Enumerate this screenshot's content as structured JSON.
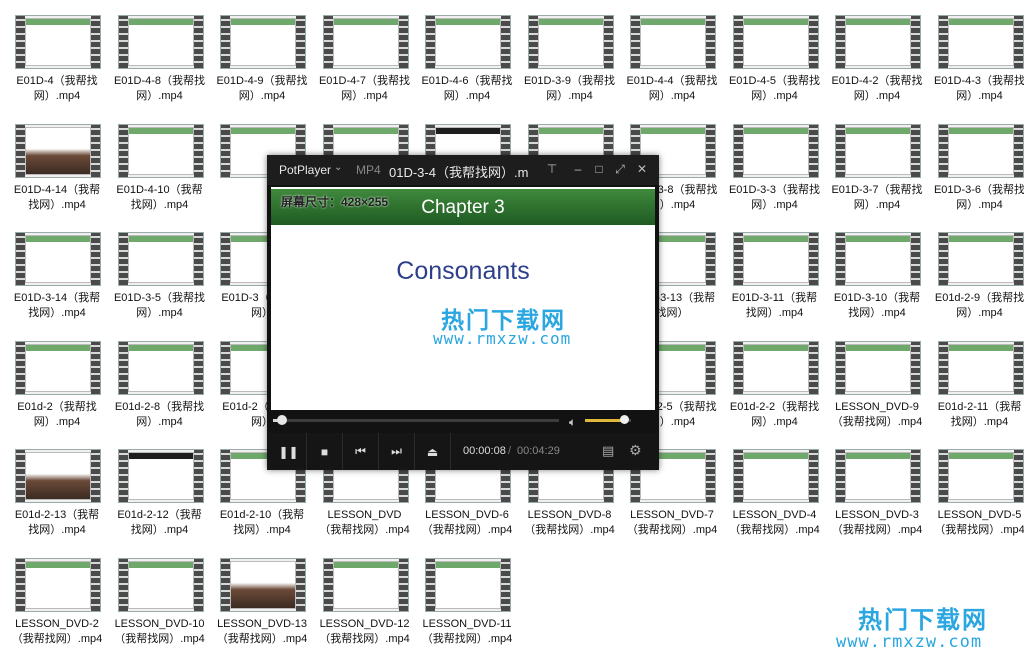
{
  "files": [
    {
      "name": "E01D-4（我帮找网）.mp4",
      "thumb": "green"
    },
    {
      "name": "E01D-4-8（我帮找网）.mp4",
      "thumb": "green"
    },
    {
      "name": "E01D-4-9（我帮找网）.mp4",
      "thumb": "green"
    },
    {
      "name": "E01D-4-7（我帮找网）.mp4",
      "thumb": "green"
    },
    {
      "name": "E01D-4-6（我帮找网）.mp4",
      "thumb": "green"
    },
    {
      "name": "E01D-3-9（我帮找网）.mp4",
      "thumb": "green"
    },
    {
      "name": "E01D-4-4（我帮找网）.mp4",
      "thumb": "green"
    },
    {
      "name": "E01D-4-5（我帮找网）.mp4",
      "thumb": "green"
    },
    {
      "name": "E01D-4-2（我帮找网）.mp4",
      "thumb": "green"
    },
    {
      "name": "E01D-4-3（我帮找网）.mp4",
      "thumb": "green"
    },
    {
      "name": "E01D-4-14（我帮找网）.mp4",
      "thumb": "photo"
    },
    {
      "name": "E01D-4-10（我帮找网）.mp4",
      "thumb": "green"
    },
    {
      "name": "",
      "thumb": "green"
    },
    {
      "name": "",
      "thumb": "green"
    },
    {
      "name": "",
      "thumb": "dark"
    },
    {
      "name": "",
      "thumb": "green"
    },
    {
      "name": "E01D-3-8（我帮找网）.mp4",
      "thumb": "green"
    },
    {
      "name": "E01D-3-3（我帮找网）.mp4",
      "thumb": "green"
    },
    {
      "name": "E01D-3-7（我帮找网）.mp4",
      "thumb": "green"
    },
    {
      "name": "E01D-3-6（我帮找网）.mp4",
      "thumb": "green"
    },
    {
      "name": "E01D-3-14（我帮找网）.mp4",
      "thumb": "green"
    },
    {
      "name": "E01D-3-5（我帮找网）.mp4",
      "thumb": "green"
    },
    {
      "name": "E01D-3（我帮找网）",
      "thumb": "green"
    },
    {
      "name": "",
      "thumb": "green"
    },
    {
      "name": "",
      "thumb": "green"
    },
    {
      "name": "",
      "thumb": "green"
    },
    {
      "name": "E01D-3-13（我帮找网）",
      "thumb": "green"
    },
    {
      "name": "E01D-3-11（我帮找网）.mp4",
      "thumb": "green"
    },
    {
      "name": "E01D-3-10（我帮找网）.mp4",
      "thumb": "green"
    },
    {
      "name": "E01d-2-9（我帮找网）.mp4",
      "thumb": "green"
    },
    {
      "name": "E01d-2（我帮找网）.mp4",
      "thumb": "green"
    },
    {
      "name": "E01d-2-8（我帮找网）.mp4",
      "thumb": "green"
    },
    {
      "name": "E01d-2（我帮找网）",
      "thumb": "green"
    },
    {
      "name": "",
      "thumb": "green"
    },
    {
      "name": "",
      "thumb": "green"
    },
    {
      "name": "",
      "thumb": "green"
    },
    {
      "name": "E01d-2-5（我帮找网）.mp4",
      "thumb": "green"
    },
    {
      "name": "E01d-2-2（我帮找网）.mp4",
      "thumb": "green"
    },
    {
      "name": "LESSON_DVD-9（我帮找网）.mp4",
      "thumb": "green"
    },
    {
      "name": "E01d-2-11（我帮找网）.mp4",
      "thumb": "green"
    },
    {
      "name": "E01d-2-13（我帮找网）.mp4",
      "thumb": "photo"
    },
    {
      "name": "E01d-2-12（我帮找网）.mp4",
      "thumb": "dark"
    },
    {
      "name": "E01d-2-10（我帮找网）.mp4",
      "thumb": "green"
    },
    {
      "name": "LESSON_DVD（我帮找网）.mp4",
      "thumb": "green"
    },
    {
      "name": "LESSON_DVD-6（我帮找网）.mp4",
      "thumb": "green"
    },
    {
      "name": "LESSON_DVD-8（我帮找网）.mp4",
      "thumb": "green"
    },
    {
      "name": "LESSON_DVD-7（我帮找网）.mp4",
      "thumb": "green"
    },
    {
      "name": "LESSON_DVD-4（我帮找网）.mp4",
      "thumb": "green"
    },
    {
      "name": "LESSON_DVD-3（我帮找网）.mp4",
      "thumb": "green"
    },
    {
      "name": "LESSON_DVD-5（我帮找网）.mp4",
      "thumb": "green"
    },
    {
      "name": "LESSON_DVD-2（我帮找网）.mp4",
      "thumb": "green"
    },
    {
      "name": "LESSON_DVD-10（我帮找网）.mp4",
      "thumb": "green"
    },
    {
      "name": "LESSON_DVD-13（我帮找网）.mp4",
      "thumb": "photo"
    },
    {
      "name": "LESSON_DVD-12（我帮找网）.mp4",
      "thumb": "green"
    },
    {
      "name": "LESSON_DVD-11（我帮找网）.mp4",
      "thumb": "green"
    }
  ],
  "player": {
    "brand": "PotPlayer",
    "brand_menu_icon": "chevron-down-icon",
    "format": "MP4",
    "title": "01D-3-4（我帮找网）.m",
    "window_buttons": [
      "pin-icon",
      "minimize-icon",
      "maximize-icon",
      "fullscreen-icon",
      "close-icon"
    ],
    "video": {
      "osd": "屏幕尺寸：428×255",
      "chapter": "Chapter 3",
      "topic": "Consonants"
    },
    "seek_progress": 0.03,
    "volume": 0.85,
    "controls": {
      "play_pause_icon": "pause-icon",
      "stop_icon": "stop-icon",
      "prev_icon": "previous-icon",
      "next_icon": "next-icon",
      "eject_icon": "eject-icon"
    },
    "time_current": "00:00:08",
    "time_separator": "/",
    "time_total": "00:04:29"
  },
  "watermark": {
    "cn": "热门下载网",
    "url": "www.rmxzw.com"
  },
  "colors": {
    "accent_green": "#3f8a3c",
    "watermark_blue": "#2aa6e0",
    "volume_gold": "#e0b83a"
  }
}
